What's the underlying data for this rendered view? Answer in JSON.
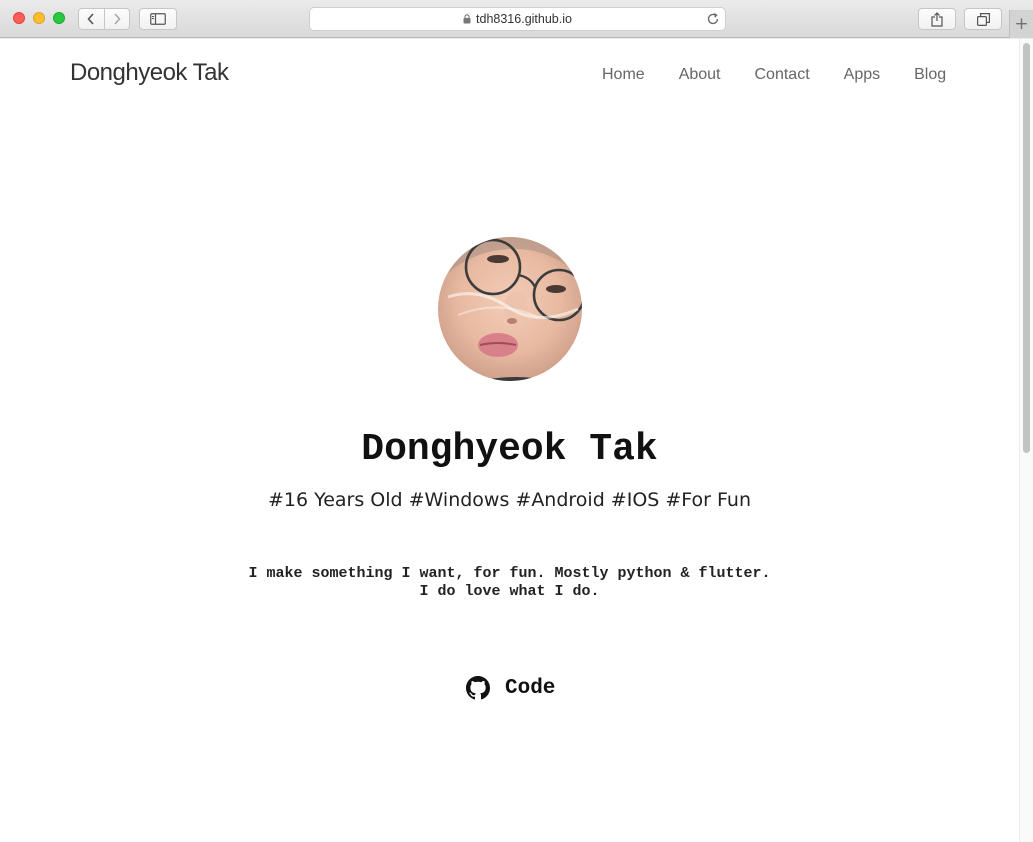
{
  "browser": {
    "url": "tdh8316.github.io"
  },
  "site": {
    "brand": "Donghyeok Tak",
    "nav": [
      "Home",
      "About",
      "Contact",
      "Apps",
      "Blog"
    ]
  },
  "profile": {
    "name": "Donghyeok Tak",
    "tags": "#16 Years Old #Windows #Android #IOS #For Fun",
    "bio_line1": "I make something I want, for fun. Mostly python & flutter.",
    "bio_line2": "I do love what I do.",
    "code_label": "Code"
  },
  "icons": {
    "code_link": "github-icon"
  }
}
